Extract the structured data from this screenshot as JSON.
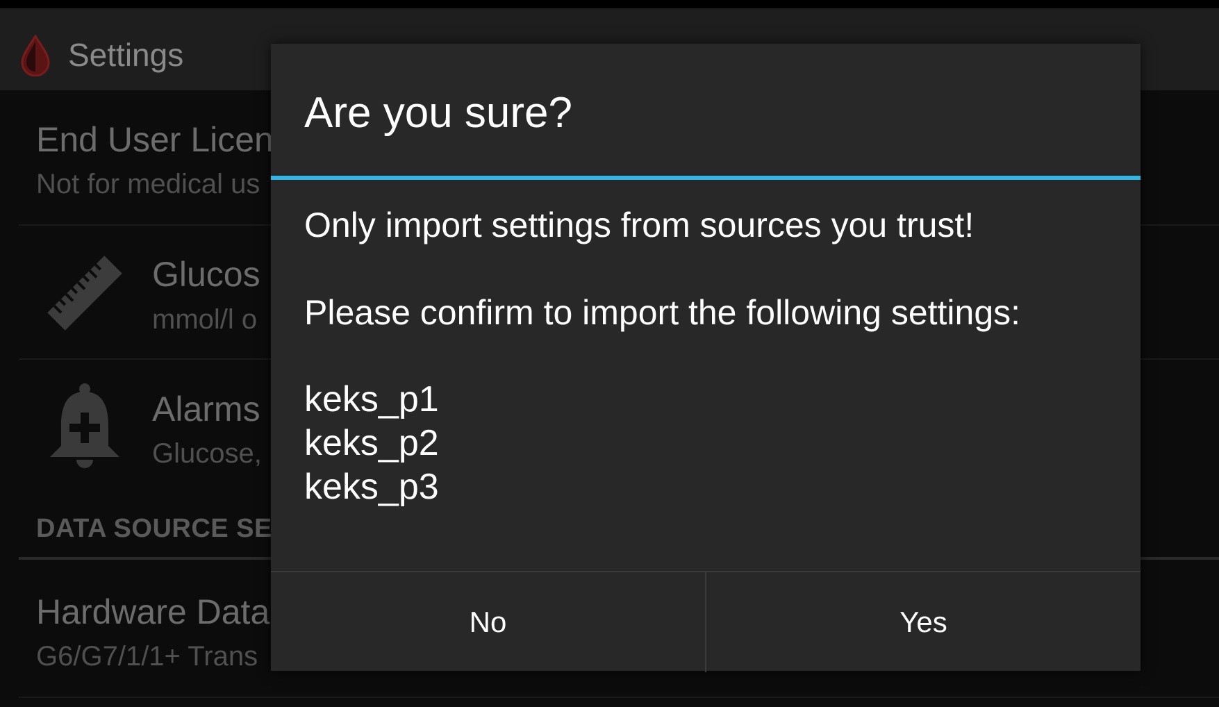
{
  "action_bar": {
    "title": "Settings",
    "icon": "blood-drop-icon"
  },
  "settings_list": {
    "license": {
      "title": "End User Licen",
      "summary": "Not for medical us"
    },
    "glucose": {
      "icon": "ruler-icon",
      "title": "Glucos",
      "summary": "mmol/l o"
    },
    "alarms": {
      "icon": "bell-plus-icon",
      "title": "Alarms",
      "summary": "Glucose,"
    },
    "category_header": "DATA SOURCE SE",
    "hardware": {
      "title": "Hardware Data",
      "summary": "G6/G7/1/1+ Trans"
    }
  },
  "dialog": {
    "title": "Are you sure?",
    "message_line1": "Only import settings from sources you trust!",
    "message_line2": "Please confirm to import the following settings:",
    "settings": [
      "keks_p1",
      "keks_p2",
      "keks_p3"
    ],
    "button_no": "No",
    "button_yes": "Yes",
    "accent_color": "#33b5e5"
  }
}
